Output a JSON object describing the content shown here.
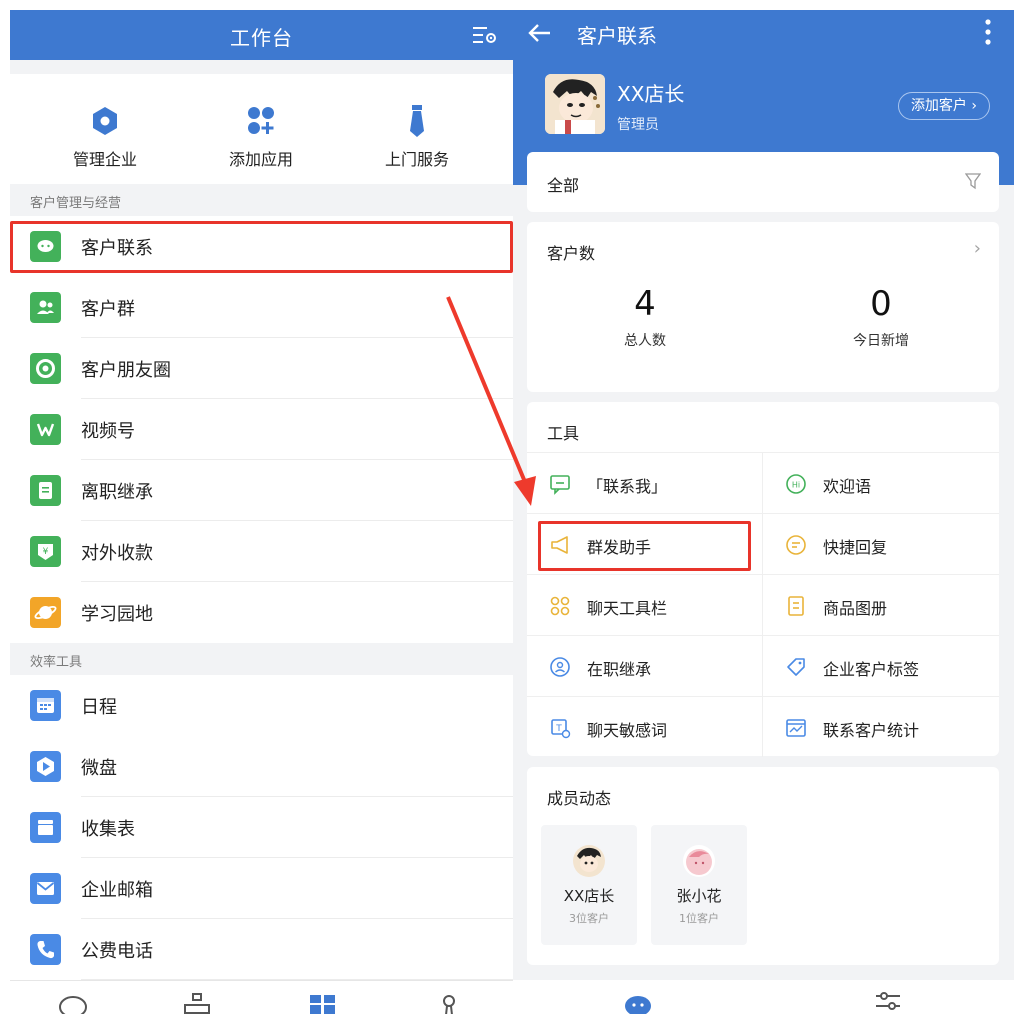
{
  "left": {
    "header": {
      "title": "工作台"
    },
    "quick": [
      {
        "label": "管理企业",
        "icon": "hexagon-icon"
      },
      {
        "label": "添加应用",
        "icon": "apps-add-icon"
      },
      {
        "label": "上门服务",
        "icon": "tie-icon"
      }
    ],
    "section1": "客户管理与经营",
    "items1": [
      {
        "label": "客户联系",
        "icon": "chat-bubble-icon",
        "color": "#43b15a"
      },
      {
        "label": "客户群",
        "icon": "group-icon",
        "color": "#43b15a"
      },
      {
        "label": "客户朋友圈",
        "icon": "moments-icon",
        "color": "#43b15a"
      },
      {
        "label": "视频号",
        "icon": "channels-icon",
        "color": "#43b15a"
      },
      {
        "label": "离职继承",
        "icon": "document-icon",
        "color": "#43b15a"
      },
      {
        "label": "对外收款",
        "icon": "yen-icon",
        "color": "#43b15a"
      },
      {
        "label": "学习园地",
        "icon": "planet-icon",
        "color": "#f2a528"
      }
    ],
    "section2": "效率工具",
    "items2": [
      {
        "label": "日程",
        "icon": "calendar-icon",
        "color": "#4a8ae5"
      },
      {
        "label": "微盘",
        "icon": "drive-icon",
        "color": "#4a8ae5"
      },
      {
        "label": "收集表",
        "icon": "form-icon",
        "color": "#4a8ae5"
      },
      {
        "label": "企业邮箱",
        "icon": "mail-icon",
        "color": "#4a8ae5"
      },
      {
        "label": "公费电话",
        "icon": "phone-icon",
        "color": "#4a8ae5"
      }
    ]
  },
  "right": {
    "header": {
      "title": "客户联系"
    },
    "user": {
      "name": "XX店长",
      "role": "管理员",
      "add_button": "添加客户"
    },
    "filter": {
      "label": "全部"
    },
    "stats": {
      "title": "客户数",
      "total_value": "4",
      "total_label": "总人数",
      "today_value": "0",
      "today_label": "今日新增"
    },
    "tools": {
      "title": "工具",
      "items": [
        {
          "label": "「联系我」",
          "icon": "contact-me-icon"
        },
        {
          "label": "欢迎语",
          "icon": "hi-icon"
        },
        {
          "label": "群发助手",
          "icon": "megaphone-icon"
        },
        {
          "label": "快捷回复",
          "icon": "quick-reply-icon"
        },
        {
          "label": "聊天工具栏",
          "icon": "toolbar-icon"
        },
        {
          "label": "商品图册",
          "icon": "catalog-icon"
        },
        {
          "label": "在职继承",
          "icon": "transfer-icon"
        },
        {
          "label": "企业客户标签",
          "icon": "tag-icon"
        },
        {
          "label": "聊天敏感词",
          "icon": "sensitive-word-icon"
        },
        {
          "label": "联系客户统计",
          "icon": "stats-icon"
        }
      ]
    },
    "members": {
      "title": "成员动态",
      "list": [
        {
          "name": "XX店长",
          "count": "3位客户"
        },
        {
          "name": "张小花",
          "count": "1位客户"
        }
      ]
    }
  },
  "colors": {
    "brand": "#3e79d0",
    "highlight": "#e8342a",
    "green": "#43b15a",
    "blue": "#4a8ae5"
  }
}
